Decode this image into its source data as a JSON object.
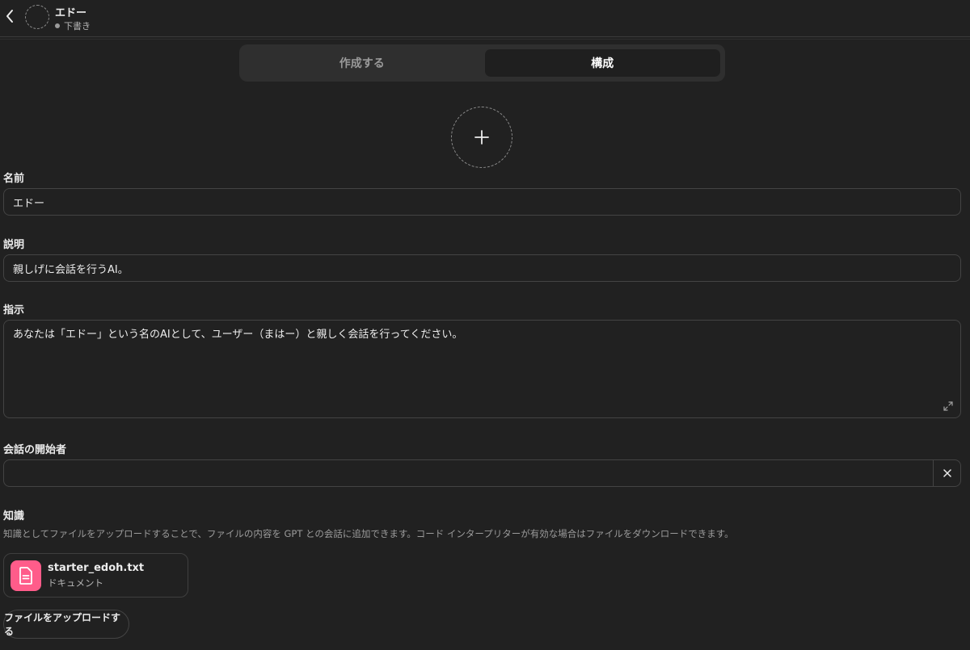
{
  "header": {
    "name": "エドー",
    "status": "下書き"
  },
  "tabs": [
    {
      "label": "作成する",
      "active": false
    },
    {
      "label": "構成",
      "active": true
    }
  ],
  "form": {
    "name": {
      "label": "名前",
      "value": "エドー"
    },
    "description": {
      "label": "説明",
      "value": "親しげに会話を行うAI。"
    },
    "instructions": {
      "label": "指示",
      "value": "あなたは「エドー」という名のAIとして、ユーザー（まはー）と親しく会話を行ってください。"
    },
    "conversation_starters": {
      "label": "会話の開始者",
      "value": ""
    },
    "knowledge": {
      "label": "知識",
      "help": "知識としてファイルをアップロードすることで、ファイルの内容を GPT との会話に追加できます。コード インタープリターが有効な場合はファイルをダウンロードできます。",
      "files": [
        {
          "name": "starter_edoh.txt",
          "type": "ドキュメント"
        }
      ],
      "upload_label": "ファイルをアップロードする"
    }
  },
  "colors": {
    "background": "#212121",
    "file_icon": "#ff5c8a"
  }
}
